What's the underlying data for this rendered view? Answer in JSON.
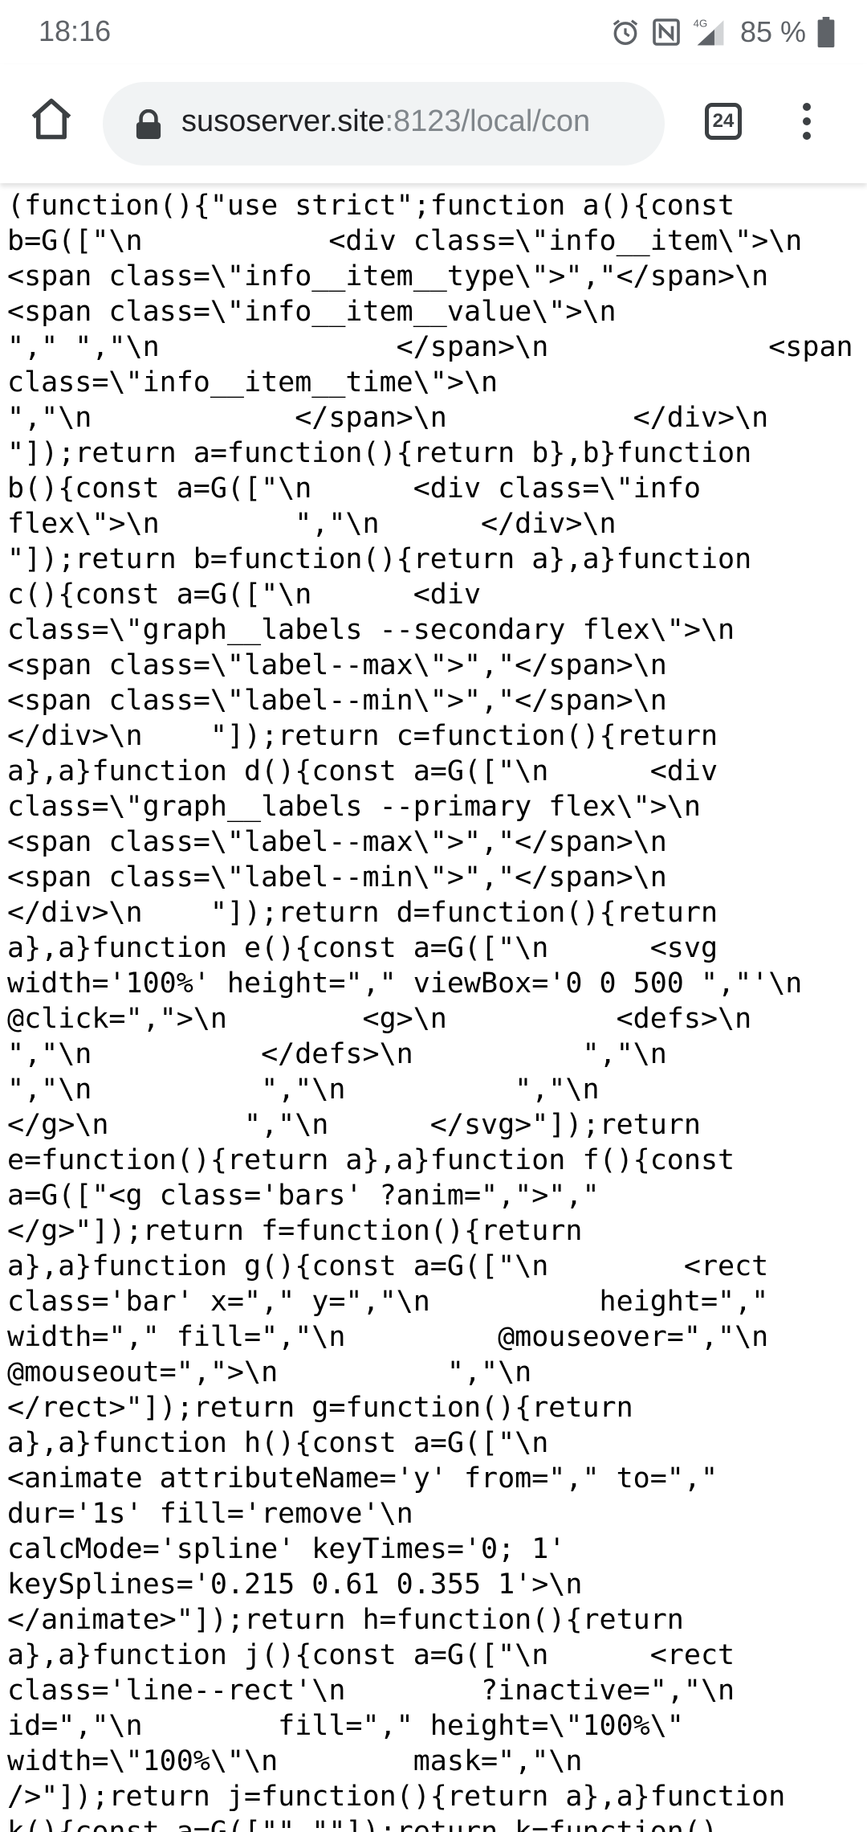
{
  "status_bar": {
    "time": "18:16",
    "network": "4G",
    "battery": "85 %"
  },
  "toolbar": {
    "url_host": "susoserver.site",
    "url_rest": ":8123/local/con",
    "tab_count": "24"
  },
  "page": {
    "source_text": "(function(){\"use strict\";function a(){const\nb=G([\"\\n           <div class=\\\"info__item\\\">\\n\n<span class=\\\"info__item__type\\\">\",\"</span>\\n\n<span class=\\\"info__item__value\\\">\\n\n\",\" \",\"\\n              </span>\\n             <span\nclass=\\\"info__item__time\\\">\\n\n\",\"\\n            </span>\\n           </div>\\n\n\"]);return a=function(){return b},b}function\nb(){const a=G([\"\\n      <div class=\\\"info\nflex\\\">\\n        \",\"\\n      </div>\\n\n\"]);return b=function(){return a},a}function\nc(){const a=G([\"\\n      <div\nclass=\\\"graph__labels --secondary flex\\\">\\n\n<span class=\\\"label--max\\\">\",\"</span>\\n\n<span class=\\\"label--min\\\">\",\"</span>\\n\n</div>\\n    \"]);return c=function(){return\na},a}function d(){const a=G([\"\\n      <div\nclass=\\\"graph__labels --primary flex\\\">\\n\n<span class=\\\"label--max\\\">\",\"</span>\\n\n<span class=\\\"label--min\\\">\",\"</span>\\n\n</div>\\n    \"]);return d=function(){return\na},a}function e(){const a=G([\"\\n      <svg\nwidth='100%' height=\",\" viewBox='0 0 500 \",\"'\\n\n@click=\",\">\\n        <g>\\n          <defs>\\n\n\",\"\\n          </defs>\\n          \",\"\\n\n\",\"\\n          \",\"\\n          \",\"\\n\n</g>\\n        \",\"\\n      </svg>\"]);return\ne=function(){return a},a}function f(){const\na=G([\"<g class='bars' ?anim=\",\">\",\"\n</g>\"]);return f=function(){return\na},a}function g(){const a=G([\"\\n        <rect\nclass='bar' x=\",\" y=\",\"\\n          height=\",\"\nwidth=\",\" fill=\",\"\\n         @mouseover=\",\"\\n\n@mouseout=\",\">\\n          \",\"\\n\n</rect>\"]);return g=function(){return\na},a}function h(){const a=G([\"\\n\n<animate attributeName='y' from=\",\" to=\",\"\ndur='1s' fill='remove'\\n\ncalcMode='spline' keyTimes='0; 1'\nkeySplines='0.215 0.61 0.355 1'>\\n\n</animate>\"]);return h=function(){return\na},a}function j(){const a=G([\"\\n      <rect\nclass='line--rect'\\n        ?inactive=\",\"\\n\nid=\",\"\\n        fill=\",\" height=\\\"100%\\\"\nwidth=\\\"100%\\\"\\n        mask=\",\"\\n\n/>\"]);return j=function(){return a},a}function\nk(){const a=G([\"\",\"\"]);return k=function()"
  },
  "colors": {
    "icon": "#5f6368",
    "toolbar_icon": "#3c4043",
    "omnibox_bg": "#f1f3f4",
    "text": "#000000"
  },
  "icons": {
    "alarm": "alarm-icon",
    "nfc": "nfc-icon",
    "signal": "signal-icon",
    "battery": "battery-icon",
    "home": "home-icon",
    "lock": "lock-icon",
    "menu": "more-vert-icon"
  }
}
